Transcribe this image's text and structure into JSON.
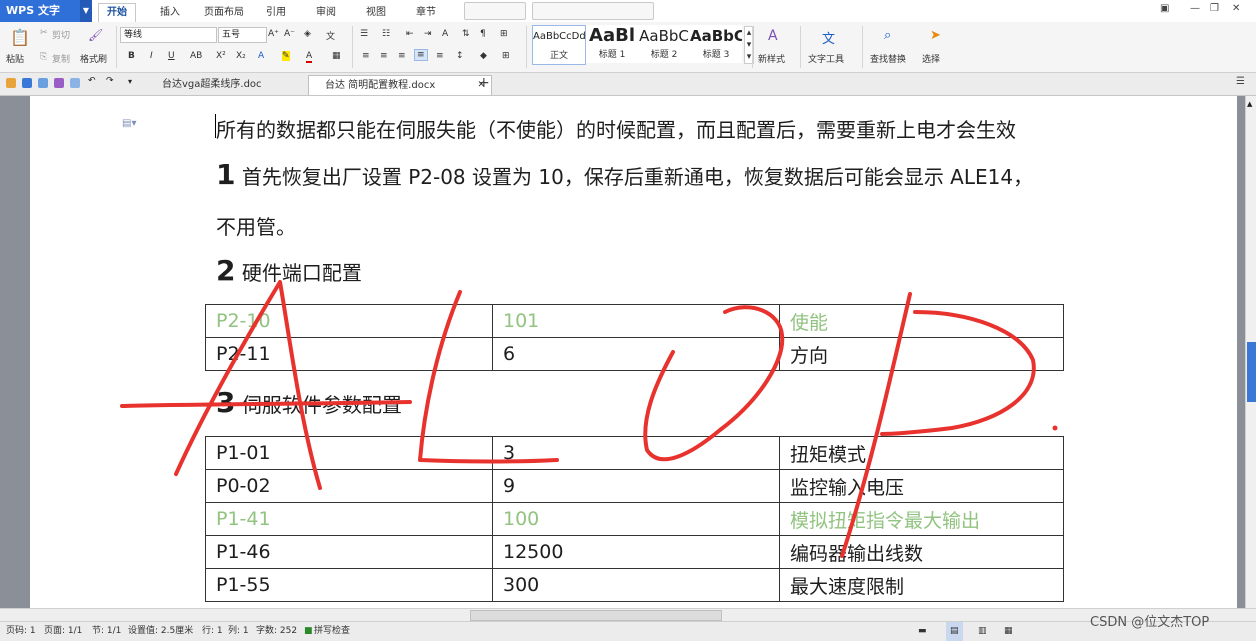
{
  "app": {
    "title": "WPS 文字"
  },
  "ribbon_tabs": [
    "开始",
    "插入",
    "页面布局",
    "引用",
    "审阅",
    "视图",
    "章节"
  ],
  "ribbon": {
    "paste": "粘贴",
    "cut": "剪切",
    "copy": "复制",
    "format_painter": "格式刷",
    "font_name": "等线",
    "font_size": "五号",
    "styles": [
      {
        "preview": "AaBbCcDd",
        "name": "正文"
      },
      {
        "preview": "AaBl",
        "name": "标题 1"
      },
      {
        "preview": "AaBbC",
        "name": "标题 2"
      },
      {
        "preview": "AaBbC",
        "name": "标题 3"
      }
    ],
    "new_style": "新样式",
    "text_tools": "文字工具",
    "find_replace": "查找替换",
    "select": "选择"
  },
  "doc_tabs": [
    {
      "label": "台达vga超柔线序.doc",
      "active": false
    },
    {
      "label": "台达 简明配置教程.docx",
      "active": true
    }
  ],
  "document": {
    "intro": "所有的数据都只能在伺服失能（不使能）的时候配置，而且配置后，需要重新上电才会生效",
    "step1_num": "1",
    "step1_text": "首先恢复出厂设置 P2-08 设置为 10，保存后重新通电，恢复数据后可能会显示 ALE14，",
    "step1_cont": "不用管。",
    "step2_num": "2",
    "step2_text": "硬件端口配置",
    "table1": [
      {
        "param": "P2-10",
        "value": "101",
        "desc": "使能",
        "highlight": true
      },
      {
        "param": "P2-11",
        "value": "6",
        "desc": "方向",
        "highlight": false
      }
    ],
    "step3_num": "3",
    "step3_text": "伺服软件参数配置",
    "table2": [
      {
        "param": "P1-01",
        "value": "3",
        "desc": "扭矩模式",
        "highlight": false
      },
      {
        "param": "P0-02",
        "value": "9",
        "desc": "监控输入电压",
        "highlight": false
      },
      {
        "param": "P1-41",
        "value": "100",
        "desc": "模拟扭矩指令最大输出",
        "highlight": true
      },
      {
        "param": "P1-46",
        "value": "12500",
        "desc": "编码器输出线数",
        "highlight": false
      },
      {
        "param": "P1-55",
        "value": "300",
        "desc": "最大速度限制",
        "highlight": false
      }
    ]
  },
  "status": {
    "page_no": "页码: 1",
    "pages": "页面: 1/1",
    "section": "节: 1/1",
    "setting": "设置值: 2.5厘米",
    "row": "行: 1",
    "col": "列: 1",
    "words": "字数: 252",
    "spell": "拼写检查"
  },
  "watermark": "CSDN @位文杰TOP",
  "colors": {
    "app_blue": "#2f6fd8",
    "highlight_green": "#92c380",
    "scribble_red": "#e8322d"
  }
}
